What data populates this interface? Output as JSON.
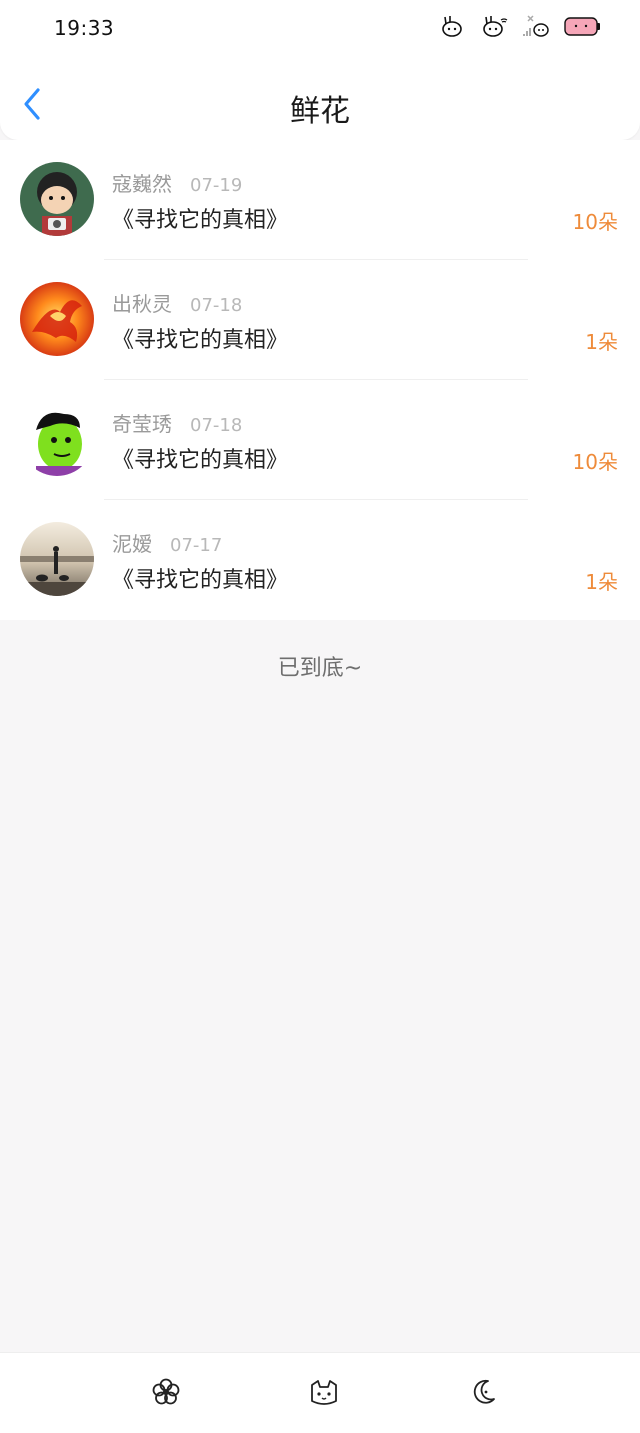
{
  "status_bar": {
    "time": "19:33"
  },
  "header": {
    "title": "鲜花",
    "accent_color": "#2f8fff"
  },
  "items": [
    {
      "name": "寇巍然",
      "date": "07-19",
      "work": "《寻找它的真相》",
      "count": "10朵"
    },
    {
      "name": "出秋灵",
      "date": "07-18",
      "work": "《寻找它的真相》",
      "count": "1朵"
    },
    {
      "name": "奇莹琇",
      "date": "07-18",
      "work": "《寻找它的真相》",
      "count": "10朵"
    },
    {
      "name": "泥嫒",
      "date": "07-17",
      "work": "《寻找它的真相》",
      "count": "1朵"
    }
  ],
  "end_text": "已到底~",
  "nav_icons": [
    "flower-icon",
    "cat-face-icon",
    "moon-icon"
  ]
}
